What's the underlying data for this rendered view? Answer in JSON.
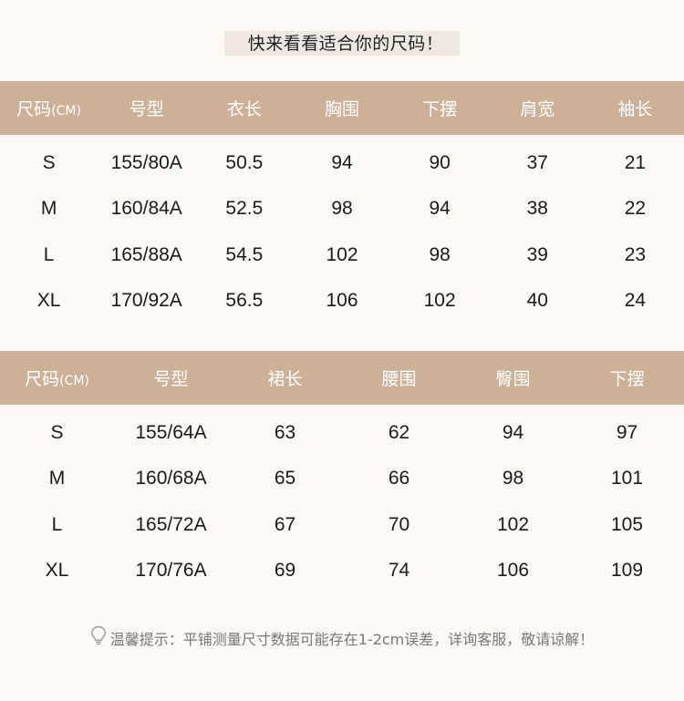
{
  "title": "快来看看适合你的尺码！",
  "top_table": {
    "headers": [
      "尺码",
      "号型",
      "衣长",
      "胸围",
      "下摆",
      "肩宽",
      "袖长"
    ],
    "size_unit": "(CM)",
    "rows": [
      [
        "S",
        "155/80A",
        "50.5",
        "94",
        "90",
        "37",
        "21"
      ],
      [
        "M",
        "160/84A",
        "52.5",
        "98",
        "94",
        "38",
        "22"
      ],
      [
        "L",
        "165/88A",
        "54.5",
        "102",
        "98",
        "39",
        "23"
      ],
      [
        "XL",
        "170/92A",
        "56.5",
        "106",
        "102",
        "40",
        "24"
      ]
    ]
  },
  "bottom_table": {
    "headers": [
      "尺码",
      "号型",
      "裙长",
      "腰围",
      "臀围",
      "下摆"
    ],
    "size_unit": "(CM)",
    "rows": [
      [
        "S",
        "155/64A",
        "63",
        "62",
        "94",
        "97"
      ],
      [
        "M",
        "160/68A",
        "65",
        "66",
        "98",
        "101"
      ],
      [
        "L",
        "165/72A",
        "67",
        "70",
        "102",
        "105"
      ],
      [
        "XL",
        "170/76A",
        "69",
        "74",
        "106",
        "109"
      ]
    ]
  },
  "footer": {
    "icon": "lightbulb-icon",
    "text": "温馨提示：平铺测量尺寸数据可能存在1-2cm误差，详询客服，敬请谅解！"
  },
  "colors": {
    "header_bg": "#cdb098",
    "page_bg": "#fdf8f3",
    "title_bg": "#efe8e1"
  }
}
